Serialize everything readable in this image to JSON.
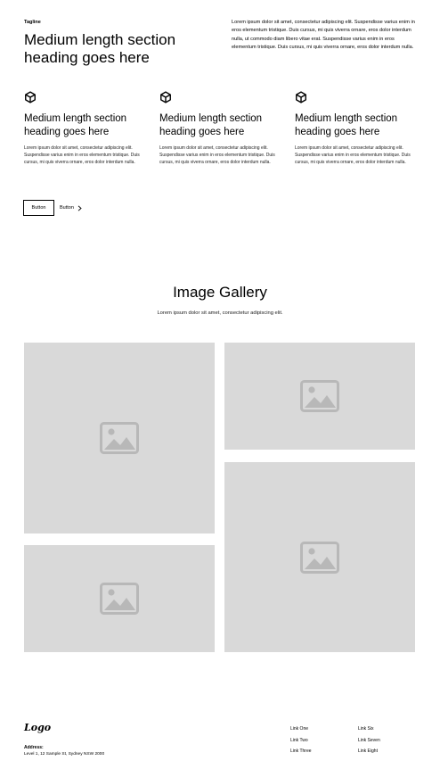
{
  "header": {
    "tagline": "Tagline",
    "heading": "Medium length section heading goes here",
    "intro": "Lorem ipsum dolor sit amet, consectetur adipiscing elit. Suspendisse varius enim in eros elementum tristique. Duis cursus, mi quis viverra ornare, eros dolor interdum nulla, ut commodo diam libero vitae erat. Suspendisse varius enim in eros elementum tristique. Duis cursus, mi quis viverra ornare, eros dolor interdum nulla."
  },
  "features": [
    {
      "icon": "cube-icon",
      "title": "Medium length section heading goes here",
      "text": "Lorem ipsum dolor sit amet, consectetur adipiscing elit. Suspendisse varius enim in eros elementum tristique. Duis cursus, mi quis viverra ornare, eros dolor interdum nulla."
    },
    {
      "icon": "cube-icon",
      "title": "Medium length section heading goes here",
      "text": "Lorem ipsum dolor sit amet, consectetur adipiscing elit. Suspendisse varius enim in eros elementum tristique. Duis cursus, mi quis viverra ornare, eros dolor interdum nulla."
    },
    {
      "icon": "cube-icon",
      "title": "Medium length section heading goes here",
      "text": "Lorem ipsum dolor sit amet, consectetur adipiscing elit. Suspendisse varius enim in eros elementum tristique. Duis cursus, mi quis viverra ornare, eros dolor interdum nulla."
    }
  ],
  "actions": {
    "primary_label": "Button",
    "secondary_label": "Button",
    "secondary_icon": "chevron-right-icon"
  },
  "gallery": {
    "title": "Image Gallery",
    "subtitle": "Lorem ipsum dolor sit amet, consectetur adipiscing elit.",
    "image_icon": "image-placeholder-icon",
    "placeholder_color": "#d9d9d9"
  },
  "footer": {
    "logo": "Logo",
    "address_label": "Address:",
    "address": "Level 1, 12 Sample St, Sydney NSW 2000",
    "links_col1": [
      "Link One",
      "Link Two",
      "Link Three"
    ],
    "links_col2": [
      "Link Six",
      "Link Seven",
      "Link Eight"
    ]
  }
}
